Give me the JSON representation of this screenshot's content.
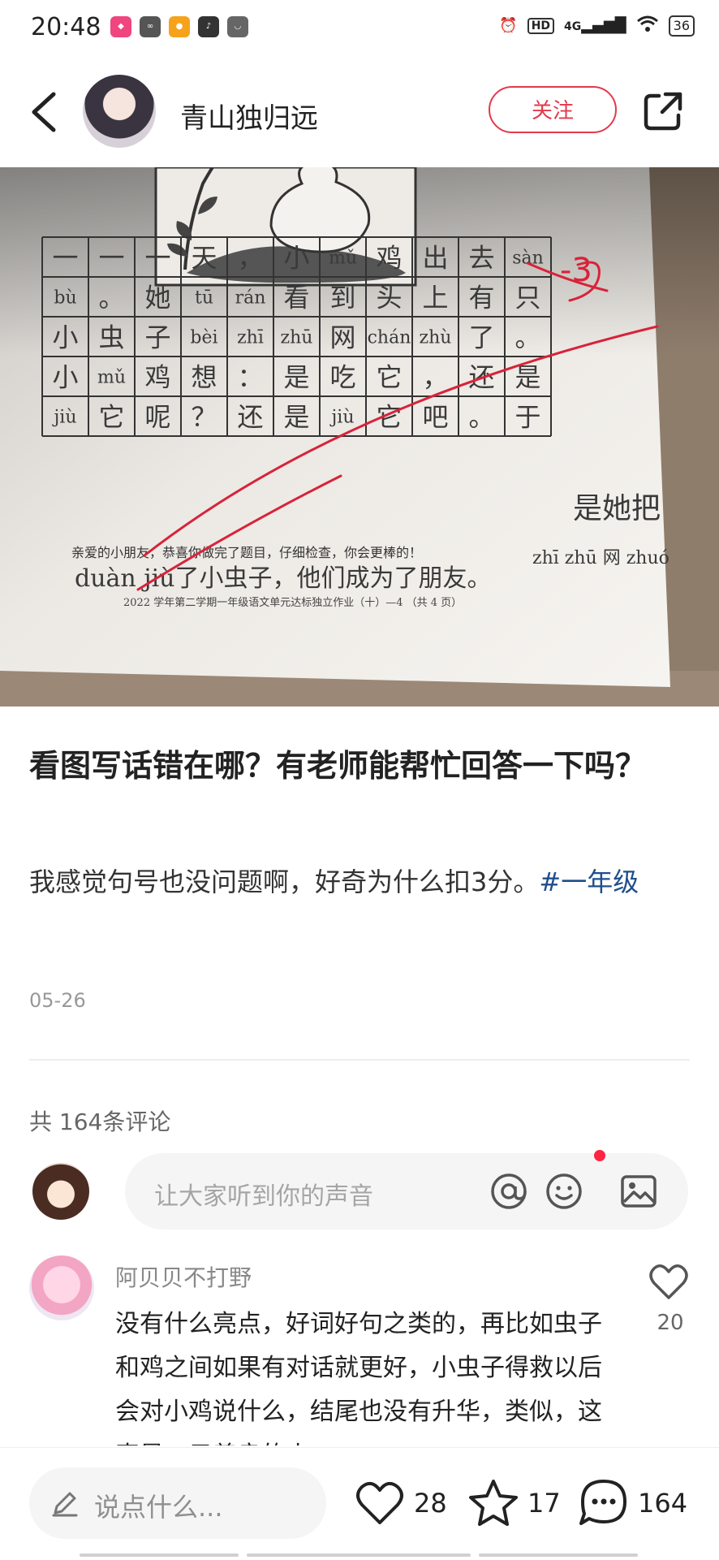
{
  "status_bar": {
    "time": "20:48",
    "signal": "4G",
    "hd": "HD",
    "battery": "36"
  },
  "header": {
    "author": "青山独归远",
    "follow_label": "关注"
  },
  "photo": {
    "grid_rows": [
      [
        "一",
        "一",
        "一",
        "天",
        "，",
        "小",
        "mǔ",
        "鸡",
        "出",
        "去",
        "sàn"
      ],
      [
        "bù",
        "。",
        "她",
        "tū",
        "rán",
        "看",
        "到",
        "头",
        "上",
        "有",
        "只"
      ],
      [
        "小",
        "虫",
        "子",
        "bèi",
        "zhī",
        "zhū",
        "网",
        "chán",
        "zhù",
        "了",
        "。"
      ],
      [
        "小",
        "mǔ",
        "鸡",
        "想",
        "：",
        "是",
        "吃",
        "它",
        "，",
        "还",
        "是"
      ],
      [
        "jiù",
        "它",
        "呢",
        "？",
        "还",
        "是",
        "jiù",
        "它",
        "吧",
        "。",
        "于"
      ]
    ],
    "margin_mark": "-3",
    "overflow_text": "是她把",
    "overflow_pinyin": "zhī zhū 网 zhuó",
    "encourage_text": "亲爱的小朋友，恭喜你做完了题目，仔细检查，你会更棒的！",
    "continued_text": "duàn jiù了小虫子，他们成为了朋友。",
    "footer_text": "2022 学年第二学期一年级语文单元达标独立作业（十）—4 （共 4 页）"
  },
  "post": {
    "title": "看图写话错在哪？有老师能帮忙回答一下吗？",
    "desc": "我感觉句号也没问题啊，好奇为什么扣3分。",
    "tag": "#一年级",
    "date": "05-26"
  },
  "comments": {
    "count_label": "共 164条评论",
    "input_placeholder": "让大家听到你的声音",
    "items": [
      {
        "user": "阿贝贝不打野",
        "text": "没有什么亮点，好词好句之类的，再比如虫子和鸡之间如果有对话就更好，小虫子得救以后会对小鸡说什么，结尾也没有升华，类似，这真是一只善良的小",
        "likes": "20"
      }
    ]
  },
  "bottom_bar": {
    "say_placeholder": "说点什么...",
    "likes": "28",
    "stars": "17",
    "comments": "164"
  },
  "colors": {
    "accent": "#e3394d",
    "tag": "#1f4e8c",
    "red_pen": "#d8233a"
  }
}
